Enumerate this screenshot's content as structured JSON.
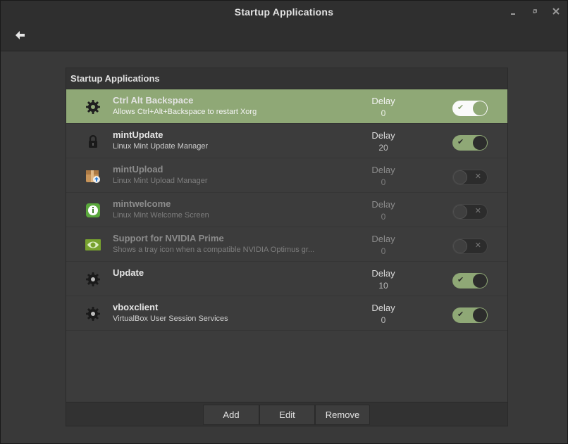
{
  "window": {
    "title": "Startup Applications",
    "controls": [
      "minimize-icon",
      "maximize-icon",
      "close-icon"
    ],
    "back_icon": "back-arrow-icon"
  },
  "panel": {
    "title": "Startup Applications",
    "accent_color": "#8fa876"
  },
  "apps": [
    {
      "name": "Ctrl Alt Backspace",
      "description": "Allows Ctrl+Alt+Backspace to restart Xorg",
      "delay_label": "Delay",
      "delay": "0",
      "enabled": true,
      "selected": true,
      "icon": "gear-icon"
    },
    {
      "name": "mintUpdate",
      "description": "Linux Mint Update Manager",
      "delay_label": "Delay",
      "delay": "20",
      "enabled": true,
      "selected": false,
      "icon": "lock-icon"
    },
    {
      "name": "mintUpload",
      "description": "Linux Mint Upload Manager",
      "delay_label": "Delay",
      "delay": "0",
      "enabled": false,
      "selected": false,
      "icon": "upload-box-icon"
    },
    {
      "name": "mintwelcome",
      "description": "Linux Mint Welcome Screen",
      "delay_label": "Delay",
      "delay": "0",
      "enabled": false,
      "selected": false,
      "icon": "info-icon"
    },
    {
      "name": "Support for NVIDIA Prime",
      "description": "Shows a tray icon when a compatible NVIDIA Optimus gr...",
      "delay_label": "Delay",
      "delay": "0",
      "enabled": false,
      "selected": false,
      "icon": "nvidia-icon"
    },
    {
      "name": "Update",
      "description": "",
      "delay_label": "Delay",
      "delay": "10",
      "enabled": true,
      "selected": false,
      "icon": "gear-icon"
    },
    {
      "name": "vboxclient",
      "description": "VirtualBox User Session Services",
      "delay_label": "Delay",
      "delay": "0",
      "enabled": true,
      "selected": false,
      "icon": "gear-icon"
    }
  ],
  "buttons": {
    "add": "Add",
    "edit": "Edit",
    "remove": "Remove"
  }
}
